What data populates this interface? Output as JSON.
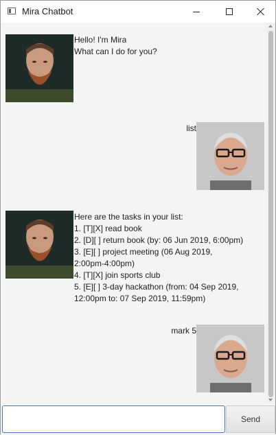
{
  "window": {
    "title": "Mira Chatbot"
  },
  "messages": [
    {
      "sender": "bot",
      "text": "Hello! I'm Mira\nWhat can I do for you?"
    },
    {
      "sender": "user",
      "text": "list"
    },
    {
      "sender": "bot",
      "text": "Here are the tasks in your list:\n1. [T][X] read book\n2. [D][ ] return book (by: 06 Jun 2019, 6:00pm)\n3. [E][ ] project meeting (06 Aug 2019,\n2:00pm-4:00pm)\n4. [T][X] join sports club\n5. [E][ ] 3-day hackathon (from: 04 Sep 2019,\n12:00pm to: 07 Sep 2019, 11:59pm)"
    },
    {
      "sender": "user",
      "text": "mark 5"
    }
  ],
  "input": {
    "value": "",
    "placeholder": ""
  },
  "send_button": {
    "label": "Send"
  },
  "colors": {
    "focus_border": "#2f7fd3",
    "background": "#f4f4f4"
  },
  "icons": [
    "app-window-icon",
    "minimize-icon",
    "maximize-icon",
    "close-icon",
    "bot-avatar",
    "user-avatar"
  ]
}
